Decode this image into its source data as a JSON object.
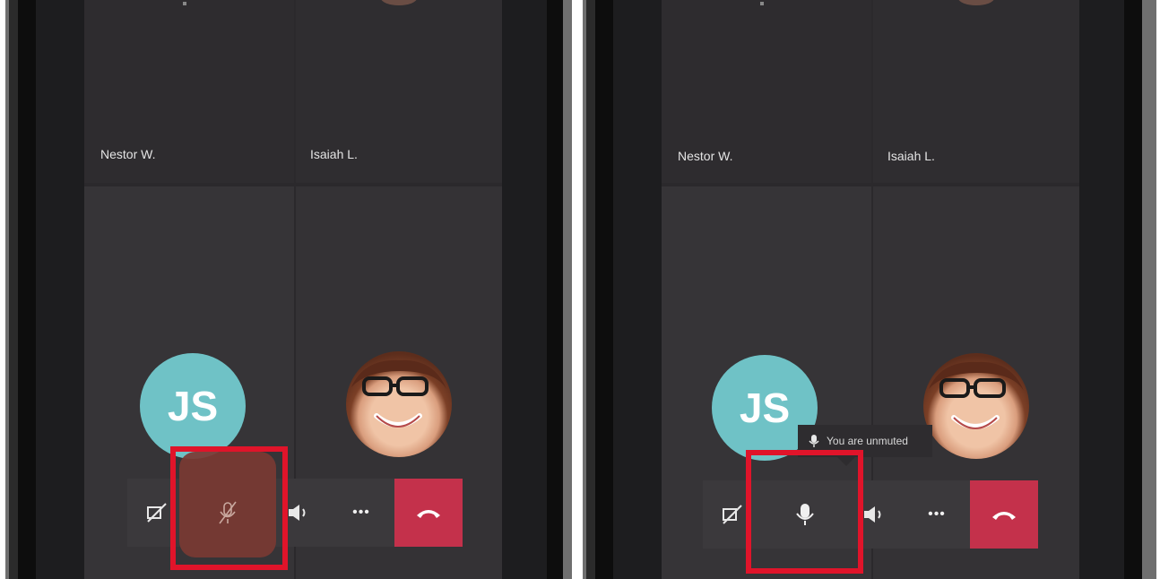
{
  "panels": [
    {
      "id": "muted",
      "participants": [
        {
          "name": "Nestor W."
        },
        {
          "name": "Isaiah L."
        }
      ],
      "avatar_initials": "JS",
      "controls": {
        "camera_icon": "camera-off-icon",
        "mic_icon": "mic-off-icon",
        "speaker_icon": "speaker-icon",
        "more_label": "•••",
        "hangup_icon": "hang-up-icon"
      },
      "mic_state": "muted"
    },
    {
      "id": "unmuted",
      "participants": [
        {
          "name": "Nestor W."
        },
        {
          "name": "Isaiah L."
        }
      ],
      "avatar_initials": "JS",
      "controls": {
        "camera_icon": "camera-off-icon",
        "mic_icon": "mic-icon",
        "speaker_icon": "speaker-icon",
        "more_label": "•••",
        "hangup_icon": "hang-up-icon"
      },
      "mic_state": "unmuted",
      "toast": "You are unmuted"
    }
  ],
  "colors": {
    "hangup": "#c4314b",
    "avatar": "#6fc2c6",
    "highlight": "#e0142a",
    "mute_glow": "#7a3a33"
  }
}
